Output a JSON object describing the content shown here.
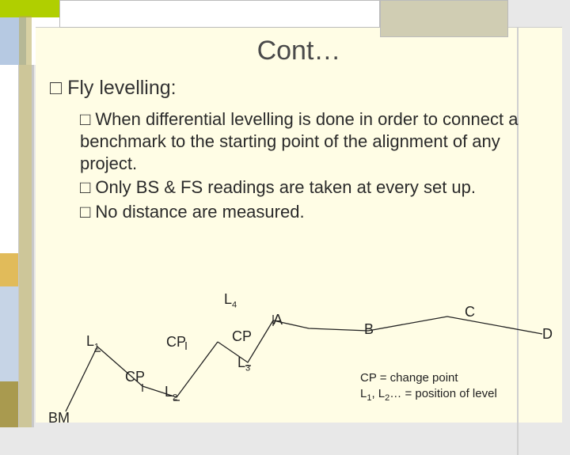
{
  "title": "Cont…",
  "main_bullet": "Fly levelling:",
  "sub": {
    "b1": "When differential levelling is done in order to connect a benchmark to the starting point of the alignment of any project.",
    "b2": "Only BS & FS readings are taken at every set up.",
    "b3": "No distance are measured."
  },
  "diagram": {
    "L1": "L",
    "L1s": "1",
    "L2": "L",
    "L2s": "2",
    "L3": "L",
    "L3s": "3",
    "L4": "L",
    "L4s": "4",
    "CP": "CP",
    "BM": "BM",
    "A": "A",
    "B": "B",
    "C": "C",
    "D": "D"
  },
  "legend": {
    "l1": "CP = change point",
    "l2_a": "L",
    "l2_b": "1",
    "l2_c": ", L",
    "l2_d": "2",
    "l2_e": "… = position of level"
  },
  "glyphs": {
    "square": "□"
  }
}
